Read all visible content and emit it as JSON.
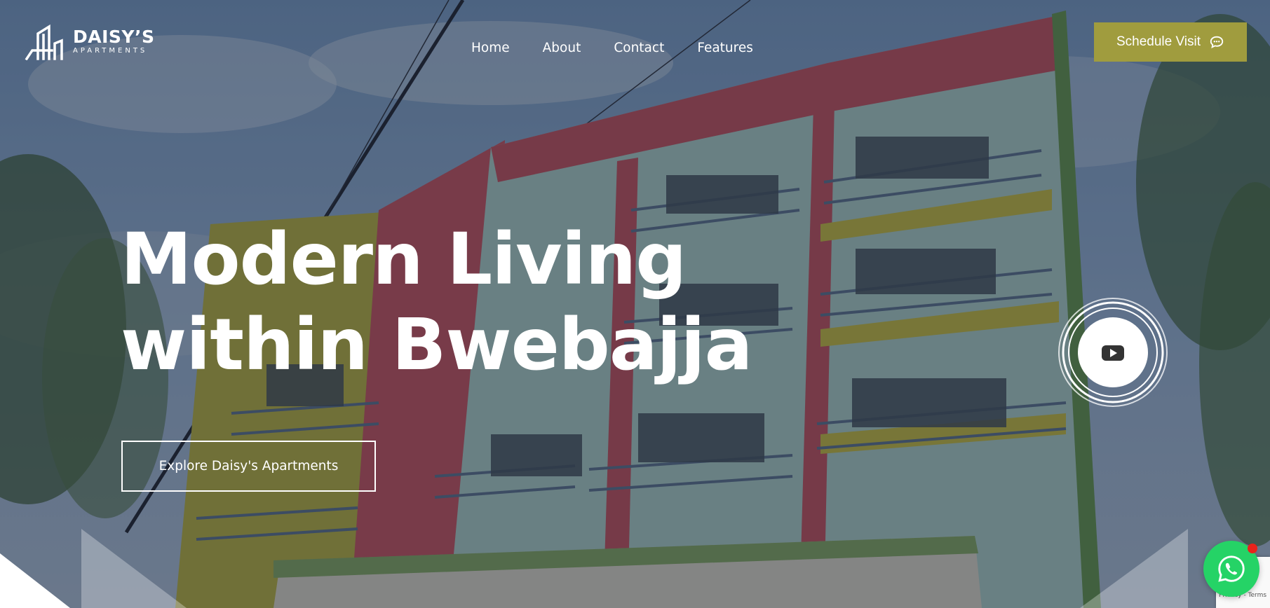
{
  "brand": {
    "name": "DAISY’S",
    "subtitle": "APARTMENTS"
  },
  "nav": {
    "items": [
      {
        "label": "Home"
      },
      {
        "label": "About"
      },
      {
        "label": "Contact"
      },
      {
        "label": "Features"
      }
    ]
  },
  "header": {
    "cta_label": "Schedule Visit",
    "cta_icon": "chat-bubble-icon"
  },
  "hero": {
    "headline_line1": "Modern Living",
    "headline_line2": "within Bwebajja",
    "explore_label": "Explore Daisy's Apartments",
    "video_icon": "youtube-play-icon"
  },
  "floating": {
    "whatsapp_icon": "whatsapp-icon"
  },
  "recaptcha": {
    "text": "Privacy - Terms"
  },
  "colors": {
    "accent": "#a09c3e",
    "whatsapp": "#25d366",
    "overlay": "#141c30"
  }
}
